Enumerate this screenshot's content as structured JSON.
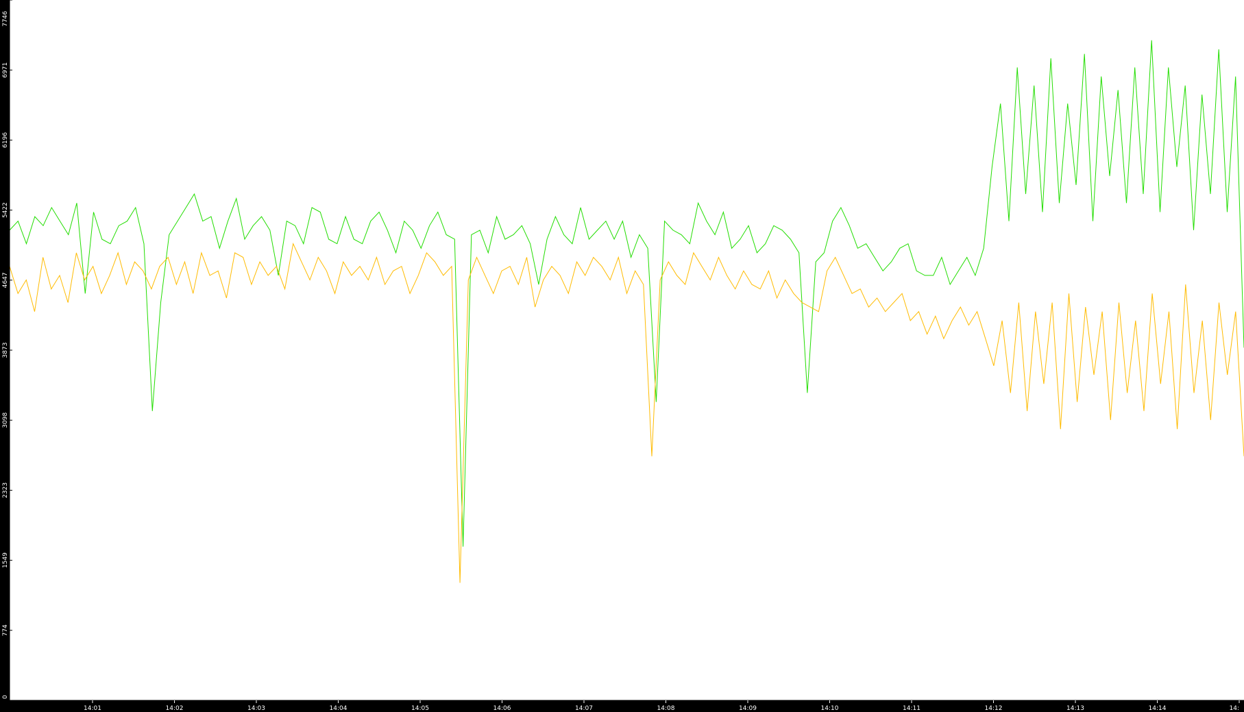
{
  "chart_data": {
    "type": "line",
    "title": "",
    "xlabel": "",
    "ylabel": "",
    "ylim": [
      0,
      7746
    ],
    "y_ticks": [
      "0",
      "774",
      "1549",
      "2323",
      "3098",
      "3873",
      "4647",
      "5422",
      "6196",
      "6971",
      "7746"
    ],
    "x_ticks": [
      "14:01",
      "14:02",
      "14:03",
      "14:04",
      "14:05",
      "14:06",
      "14:07",
      "14:08",
      "14:09",
      "14:10",
      "14:11",
      "14:12",
      "14:13",
      "14:14",
      "14:"
    ],
    "grid": false,
    "legend": "none",
    "background": "#ffffff",
    "colors": {
      "series_green": "#22dd00",
      "series_orange": "#ffbb00",
      "axis": "#000000"
    },
    "series": [
      {
        "color": "#22dd00",
        "values": [
          5200,
          5300,
          5050,
          5350,
          5250,
          5450,
          5300,
          5150,
          5500,
          4500,
          5400,
          5100,
          5050,
          5250,
          5300,
          5450,
          5050,
          3200,
          4400,
          5150,
          5300,
          5450,
          5600,
          5300,
          5350,
          5000,
          5300,
          5550,
          5100,
          5250,
          5350,
          5200,
          4700,
          5300,
          5250,
          5050,
          5450,
          5400,
          5100,
          5050,
          5350,
          5100,
          5050,
          5300,
          5400,
          5200,
          4950,
          5300,
          5200,
          5000,
          5250,
          5400,
          5150,
          5100,
          1700,
          5150,
          5200,
          4950,
          5350,
          5100,
          5150,
          5250,
          5050,
          4600,
          5100,
          5350,
          5150,
          5050,
          5450,
          5100,
          5200,
          5300,
          5100,
          5300,
          4900,
          5150,
          5000,
          3300,
          5300,
          5200,
          5150,
          5050,
          5500,
          5300,
          5150,
          5400,
          5000,
          5100,
          5250,
          4950,
          5050,
          5250,
          5200,
          5100,
          4950,
          3400,
          4850,
          4950,
          5300,
          5450,
          5250,
          5000,
          5050,
          4900,
          4750,
          4850,
          5000,
          5050,
          4750,
          4700,
          4700,
          4900,
          4600,
          4750,
          4900,
          4700,
          5000,
          5900,
          6600,
          5300,
          7000,
          5600,
          6800,
          5400,
          7100,
          5500,
          6600,
          5700,
          7150,
          5300,
          6900,
          5800,
          6750,
          5500,
          7000,
          5600,
          7300,
          5400,
          7000,
          5900,
          6800,
          5200,
          6700,
          5600,
          7200,
          5400,
          6900,
          3900
        ]
      },
      {
        "color": "#ffbb00",
        "values": [
          4800,
          4500,
          4650,
          4300,
          4900,
          4550,
          4700,
          4400,
          4950,
          4650,
          4800,
          4500,
          4700,
          4950,
          4600,
          4850,
          4750,
          4550,
          4800,
          4900,
          4600,
          4850,
          4500,
          4950,
          4700,
          4750,
          4450,
          4950,
          4900,
          4600,
          4850,
          4700,
          4800,
          4550,
          5050,
          4850,
          4650,
          4900,
          4750,
          4500,
          4850,
          4700,
          4800,
          4650,
          4900,
          4600,
          4750,
          4800,
          4500,
          4700,
          4950,
          4850,
          4700,
          4800,
          1300,
          4650,
          4900,
          4700,
          4500,
          4750,
          4800,
          4600,
          4900,
          4350,
          4650,
          4800,
          4700,
          4500,
          4850,
          4700,
          4900,
          4800,
          4650,
          4900,
          4500,
          4750,
          4600,
          2700,
          4650,
          4850,
          4700,
          4600,
          4950,
          4800,
          4650,
          4900,
          4700,
          4550,
          4750,
          4600,
          4550,
          4750,
          4450,
          4650,
          4500,
          4400,
          4350,
          4300,
          4750,
          4900,
          4700,
          4500,
          4550,
          4350,
          4450,
          4300,
          4400,
          4500,
          4200,
          4300,
          4050,
          4250,
          4000,
          4200,
          4350,
          4150,
          4300,
          4000,
          3700,
          4200,
          3400,
          4400,
          3200,
          4300,
          3500,
          4400,
          3000,
          4500,
          3300,
          4350,
          3600,
          4300,
          3100,
          4400,
          3400,
          4200,
          3200,
          4500,
          3500,
          4300,
          3000,
          4600,
          3400,
          4200,
          3100,
          4400,
          3600,
          4300,
          2700
        ]
      }
    ]
  }
}
